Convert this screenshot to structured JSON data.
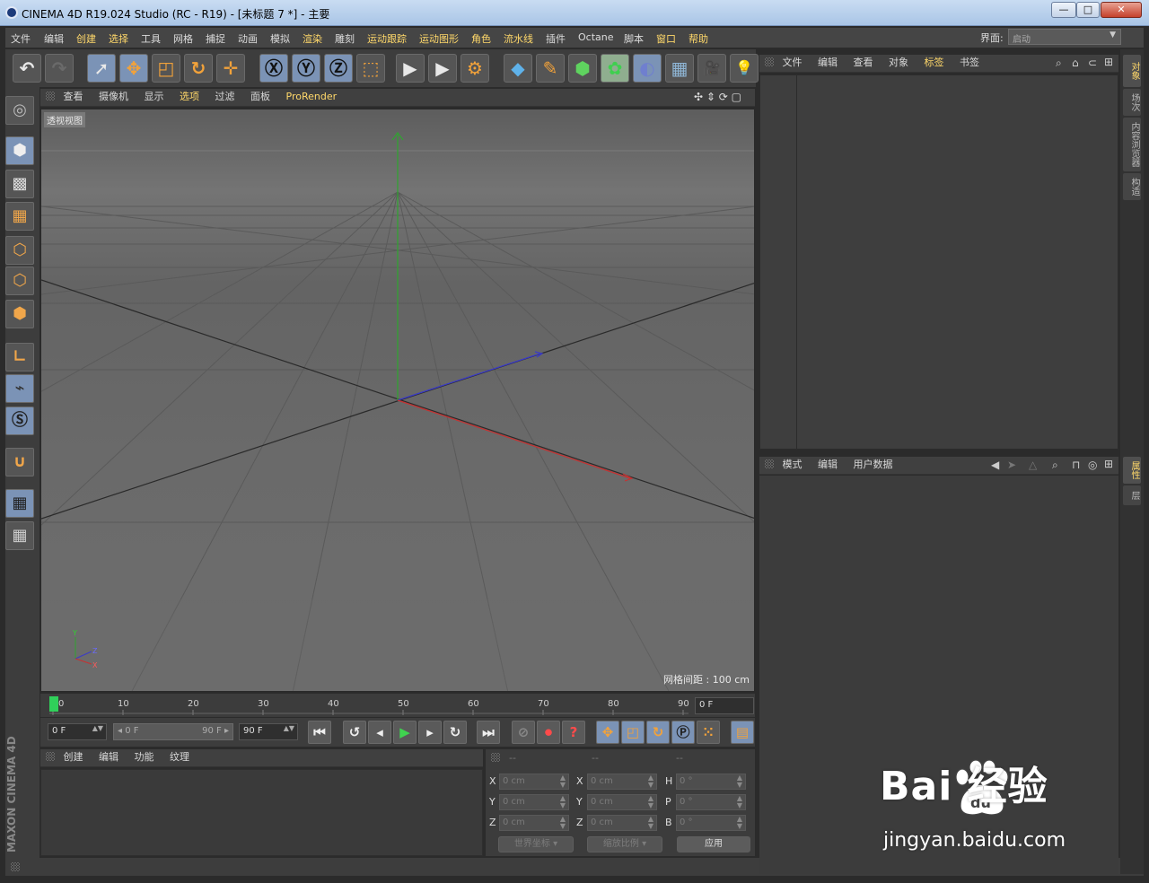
{
  "window": {
    "title": "CINEMA 4D R19.024 Studio (RC - R19) - [未标题 7 *] - 主要",
    "min": "—",
    "max": "□",
    "close": "✕"
  },
  "menubar": {
    "items": [
      {
        "label": "文件",
        "hl": false
      },
      {
        "label": "编辑",
        "hl": false
      },
      {
        "label": "创建",
        "hl": true
      },
      {
        "label": "选择",
        "hl": true
      },
      {
        "label": "工具",
        "hl": false
      },
      {
        "label": "网格",
        "hl": false
      },
      {
        "label": "捕捉",
        "hl": false
      },
      {
        "label": "动画",
        "hl": false
      },
      {
        "label": "模拟",
        "hl": false
      },
      {
        "label": "渲染",
        "hl": true
      },
      {
        "label": "雕刻",
        "hl": false
      },
      {
        "label": "运动跟踪",
        "hl": true
      },
      {
        "label": "运动图形",
        "hl": true
      },
      {
        "label": "角色",
        "hl": true
      },
      {
        "label": "流水线",
        "hl": true
      },
      {
        "label": "插件",
        "hl": false
      },
      {
        "label": "Octane",
        "hl": false
      },
      {
        "label": "脚本",
        "hl": false
      },
      {
        "label": "窗口",
        "hl": true
      },
      {
        "label": "帮助",
        "hl": true
      }
    ],
    "interface_label": "界面:",
    "interface_value": "启动"
  },
  "toolbar": {
    "undo": "↶",
    "redo": "↷",
    "select": "➚",
    "move": "✥",
    "scale": "◰",
    "rotate": "↻",
    "add": "✛",
    "axis_x": "Ⓧ",
    "axis_y": "Ⓨ",
    "axis_z": "Ⓩ",
    "coord": "⬚",
    "render_view": "▶",
    "render_pv": "▶",
    "render_settings": "⚙",
    "cube": "◆",
    "pen": "✎",
    "subdiv": "⬢",
    "cloner": "✿",
    "deformer": "◐",
    "floor": "▦",
    "camera": "🎥",
    "light": "💡"
  },
  "viewport": {
    "menus": [
      "查看",
      "摄像机",
      "显示",
      "选项",
      "过滤",
      "面板",
      "ProRender"
    ],
    "menus_hl": [
      false,
      false,
      false,
      true,
      false,
      false,
      true
    ],
    "label": "透视视图",
    "grid_spacing": "网格间距 : 100 cm",
    "nav": "✣ ⇕ ⟳ ▢"
  },
  "timeline": {
    "ticks": [
      "0",
      "10",
      "20",
      "30",
      "40",
      "50",
      "60",
      "70",
      "80",
      "90"
    ],
    "current_frame": "0 F"
  },
  "transport": {
    "start": "0 F",
    "range_start": "◂ 0 F",
    "range_end": "90 F ▸",
    "end": "90 F",
    "spin": "▲▼"
  },
  "materials": {
    "menus": [
      "创建",
      "编辑",
      "功能",
      "纹理"
    ]
  },
  "coordinates": {
    "head": [
      "--",
      "--",
      "--"
    ],
    "pos_labels": [
      "X",
      "Y",
      "Z"
    ],
    "size_labels": [
      "X",
      "Y",
      "Z"
    ],
    "rot_labels": [
      "H",
      "P",
      "B"
    ],
    "pos": [
      "0 cm",
      "0 cm",
      "0 cm"
    ],
    "size": [
      "0 cm",
      "0 cm",
      "0 cm"
    ],
    "rot": [
      "0 °",
      "0 °",
      "0 °"
    ],
    "world": "世界坐标",
    "scale": "缩放比例",
    "apply": "应用"
  },
  "objects": {
    "menus": [
      "文件",
      "编辑",
      "查看",
      "对象",
      "标签",
      "书签"
    ],
    "menus_hl": [
      false,
      false,
      false,
      false,
      true,
      false
    ]
  },
  "attributes": {
    "menus": [
      "模式",
      "编辑",
      "用户数据"
    ]
  },
  "right_tabs": {
    "top": [
      "对象",
      "场次",
      "内容浏览器",
      "构造"
    ],
    "bottom": [
      "属性",
      "层"
    ]
  },
  "brand": "MAXON CINEMA 4D",
  "watermark": {
    "main": "Bai 经验",
    "sub": "jingyan.baidu.com"
  }
}
